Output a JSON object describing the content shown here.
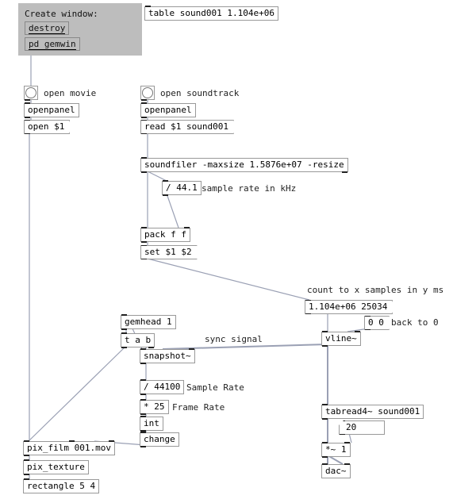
{
  "header": {
    "title": "Create window:",
    "destroy": "destroy",
    "gemwin": "pd gemwin",
    "table": "table sound001 1.104e+06"
  },
  "movie": {
    "label": "open movie",
    "openpanel": "openpanel",
    "open": "open $1"
  },
  "sound": {
    "label": "open soundtrack",
    "openpanel": "openpanel",
    "read": "read $1 sound001",
    "soundfiler": "soundfiler -maxsize 1.5876e+07 -resize",
    "div441": "/ 44.1",
    "div441_comment": "sample rate in kHz",
    "pack": "pack f f",
    "set": "set $1 $2"
  },
  "count": {
    "comment": "count to x samples in y ms",
    "values": "1.104e+06 25034",
    "back0": "0 0",
    "back0_comment": "back to 0",
    "vline": "vline~"
  },
  "sync": {
    "gemhead": "gemhead 1",
    "tab": "t a b",
    "snapshot": "snapshot~",
    "sync_label": "sync signal",
    "div44100": "/ 44100",
    "sample_rate": "Sample Rate",
    "mul25": "* 25",
    "frame_rate": "Frame Rate",
    "int": "int",
    "change": "change"
  },
  "out": {
    "pixfilm": "pix_film 001.mov",
    "pixtex": "pix_texture",
    "rect": "rectangle 5 4",
    "tabread": "tabread4~ sound001",
    "numbox": "20",
    "mul1": "*~ 1",
    "dac": "dac~"
  }
}
